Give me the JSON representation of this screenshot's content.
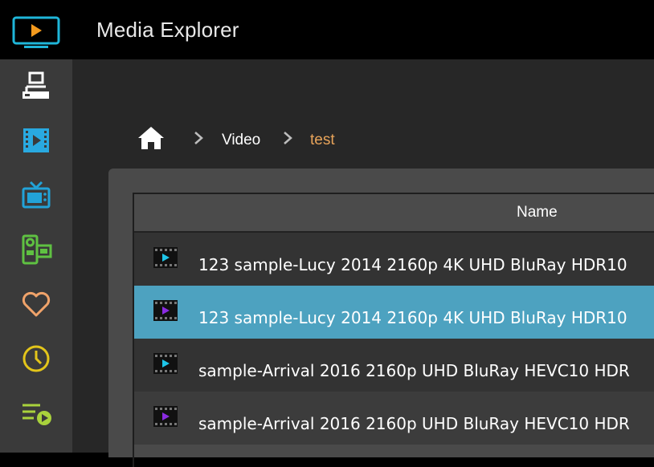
{
  "app": {
    "title": "Media Explorer"
  },
  "sidebar": {
    "items": [
      {
        "icon": "network-drive-icon",
        "color": "#ffffff"
      },
      {
        "icon": "film-icon",
        "color": "#29a9e0"
      },
      {
        "icon": "tv-icon",
        "color": "#22a3d8"
      },
      {
        "icon": "camcorder-icon",
        "color": "#5fc142"
      },
      {
        "icon": "heart-icon",
        "color": "#f0a36a"
      },
      {
        "icon": "clock-icon",
        "color": "#e3c51a"
      },
      {
        "icon": "playlist-icon",
        "color": "#a9d23c"
      }
    ]
  },
  "breadcrumb": {
    "items": [
      "Video",
      "test"
    ],
    "active_color": "#e8a45a"
  },
  "table": {
    "columns": [
      "Name"
    ],
    "rows": [
      {
        "name": "123 sample-Lucy 2014 2160p 4K UHD BluRay HDR10",
        "icon_color": "#1ec5e8"
      },
      {
        "name": "123 sample-Lucy 2014 2160p 4K UHD BluRay HDR10",
        "icon_color": "#8a2be2"
      },
      {
        "name": "sample-Arrival 2016 2160p UHD BluRay HEVC10 HDR",
        "icon_color": "#1ec5e8"
      },
      {
        "name": "sample-Arrival 2016 2160p UHD BluRay HEVC10 HDR",
        "icon_color": "#8a2be2"
      }
    ],
    "selected_color": "#4da2c0"
  }
}
